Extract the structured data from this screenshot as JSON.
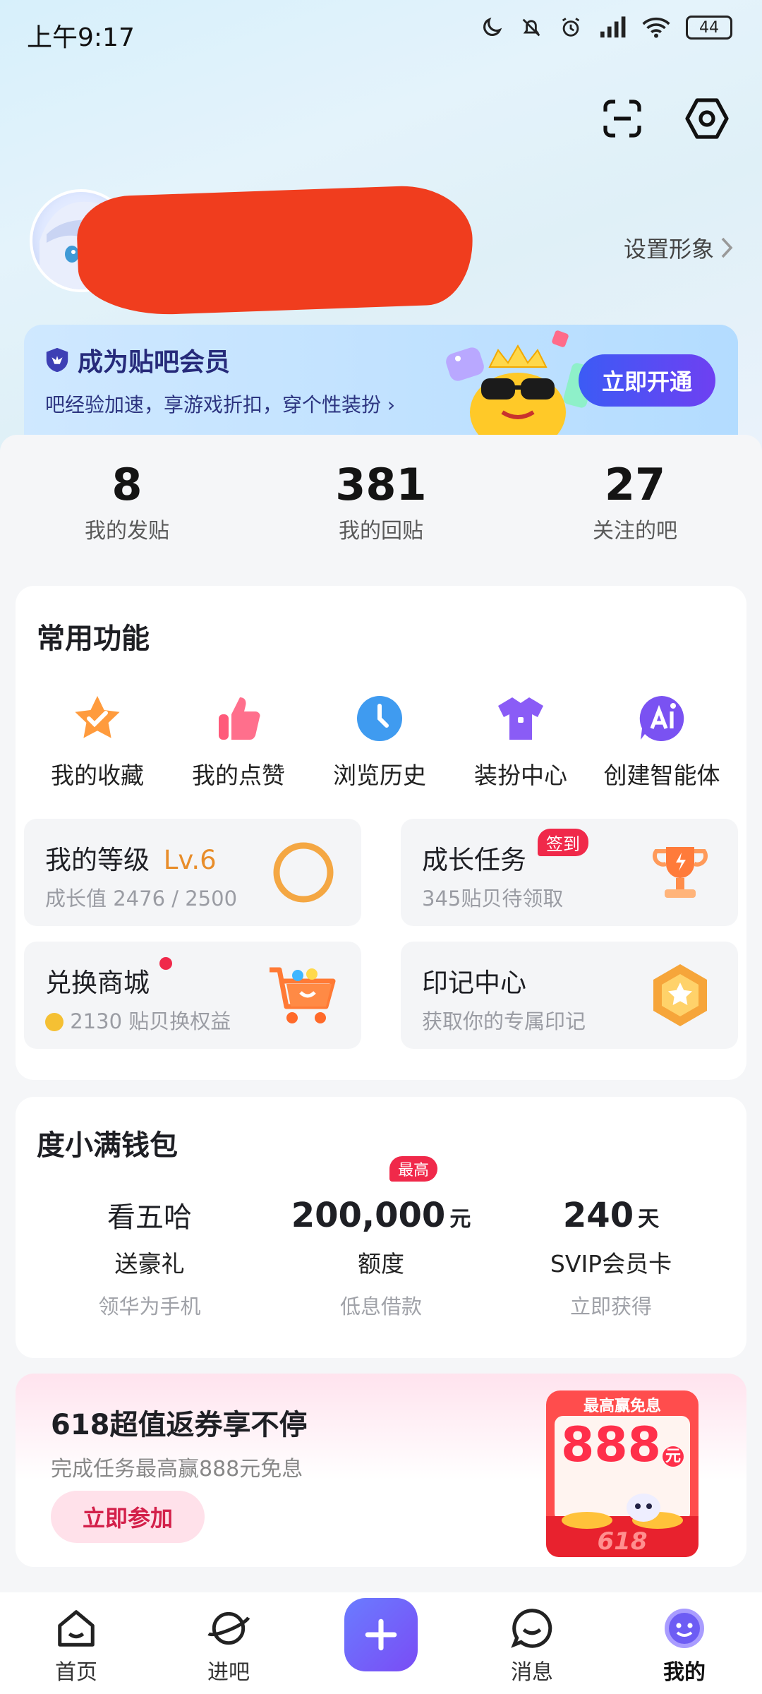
{
  "status_bar": {
    "time": "上午9:17",
    "battery": "44"
  },
  "profile": {
    "set_avatar": "设置形象"
  },
  "vip": {
    "title": "成为贴吧会员",
    "subtitle": "吧经验加速，享游戏折扣，穿个性装扮",
    "button": "立即开通"
  },
  "stats": [
    {
      "value": "8",
      "label": "我的发贴"
    },
    {
      "value": "381",
      "label": "我的回贴"
    },
    {
      "value": "27",
      "label": "关注的吧"
    }
  ],
  "functions": {
    "title": "常用功能",
    "items": [
      {
        "label": "我的收藏",
        "icon": "star-icon"
      },
      {
        "label": "我的点赞",
        "icon": "thumbs-up-icon"
      },
      {
        "label": "浏览历史",
        "icon": "clock-icon"
      },
      {
        "label": "装扮中心",
        "icon": "tshirt-icon"
      },
      {
        "label": "创建智能体",
        "icon": "ai-icon"
      }
    ]
  },
  "tiles": {
    "level": {
      "title": "我的等级",
      "level": "Lv.6",
      "sub": "成长值 2476 / 2500",
      "progress_fraction": 0.99
    },
    "growth": {
      "title": "成长任务",
      "badge": "签到",
      "sub": "345贴贝待领取"
    },
    "mall": {
      "title": "兑换商城",
      "sub": "2130 贴贝换权益"
    },
    "seal": {
      "title": "印记中心",
      "sub": "获取你的专属印记"
    }
  },
  "wallet": {
    "title": "度小满钱包",
    "cols": [
      {
        "main": "看五哈",
        "sub": "送豪礼",
        "hint": "领华为手机"
      },
      {
        "main": "200,000",
        "unit": "元",
        "badge": "最高",
        "sub": "额度",
        "hint": "低息借款"
      },
      {
        "main": "240",
        "unit": "天",
        "sub": "SVIP会员卡",
        "hint": "立即获得"
      }
    ]
  },
  "promo": {
    "title": "618超值返券享不停",
    "sub": "完成任务最高赢888元免息",
    "button": "立即参加",
    "art_top": "最高赢免息",
    "art_num": "888",
    "art_unit": "元",
    "art_tag": "618"
  },
  "nav": [
    {
      "label": "首页",
      "icon": "home-icon"
    },
    {
      "label": "进吧",
      "icon": "planet-icon"
    },
    {
      "label": "消息",
      "icon": "chat-icon"
    },
    {
      "label": "我的",
      "icon": "profile-face-icon"
    }
  ],
  "colors": {
    "accent": "#6a52f5",
    "red": "#f0294a",
    "orange": "#f6a33a"
  }
}
